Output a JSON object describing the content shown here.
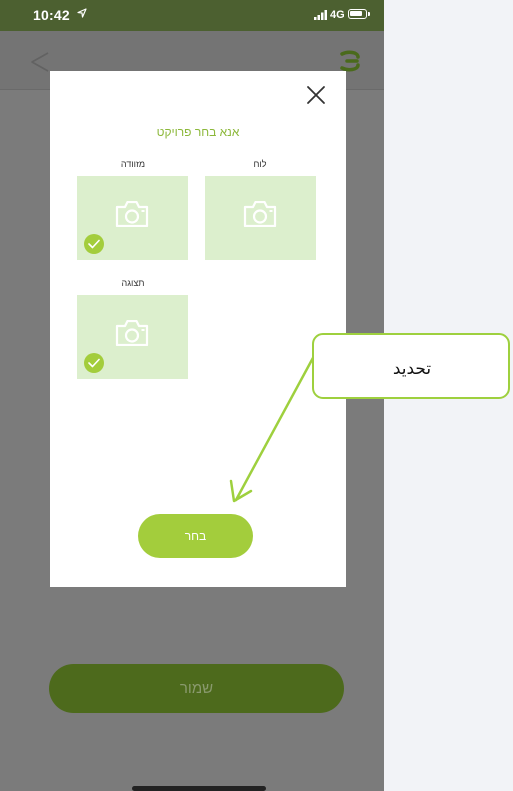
{
  "status_bar": {
    "time": "10:42",
    "network": "4G"
  },
  "modal": {
    "title": "אנא בחר פרויקט",
    "items": [
      {
        "label": "לוח",
        "selected": false
      },
      {
        "label": "מזוודה",
        "selected": true
      },
      {
        "label": "תצוגה",
        "selected": true
      }
    ],
    "choose_label": "בחר"
  },
  "footer": {
    "save_label": "שמור"
  },
  "annotation": {
    "text": "تحديد"
  },
  "colors": {
    "accent": "#a3cd3c",
    "tile": "#dcefcd",
    "status_bar": "#4c6030",
    "overlay": "#7b7b7b"
  }
}
